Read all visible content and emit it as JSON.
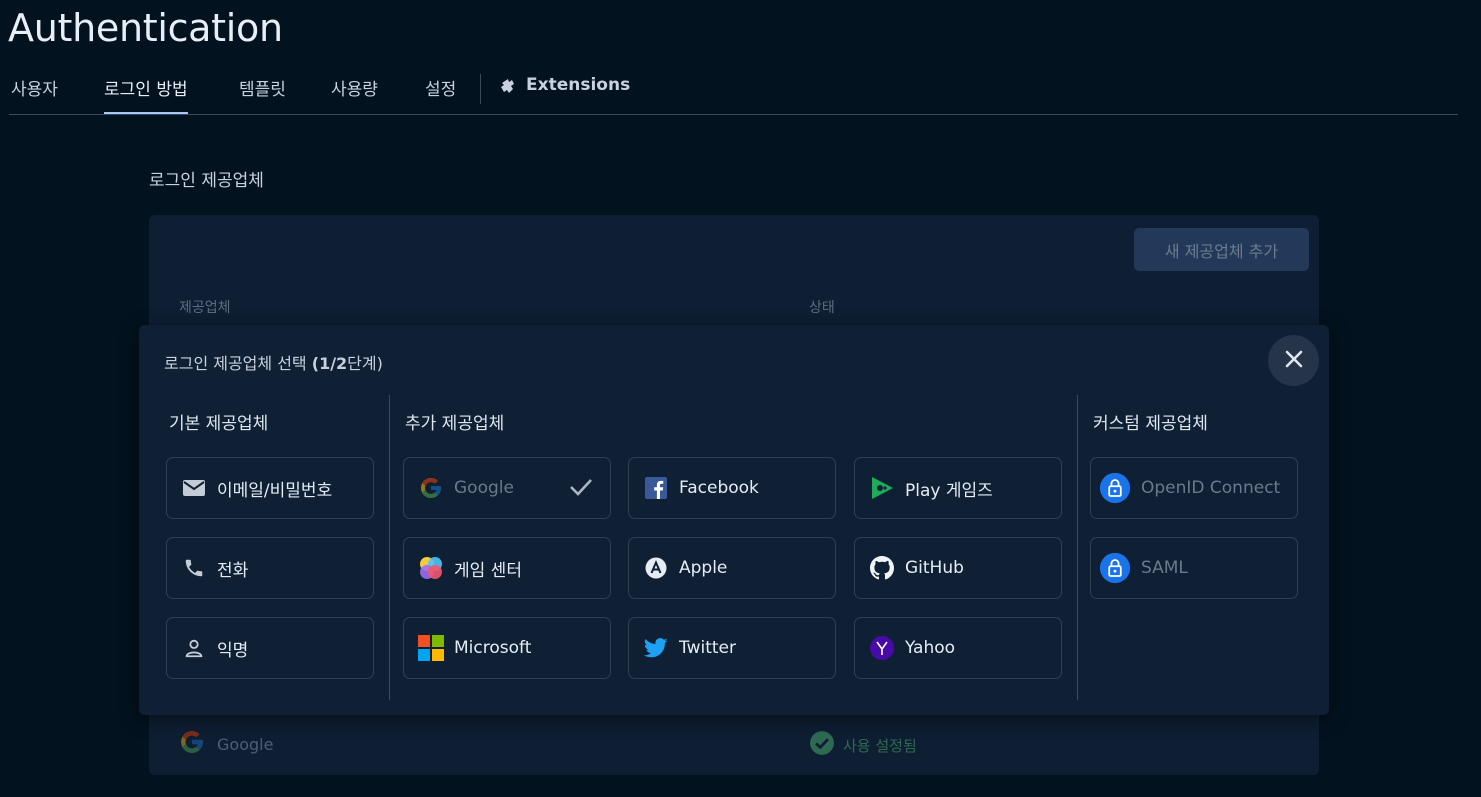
{
  "page": {
    "title": "Authentication"
  },
  "tabs": [
    {
      "label": "사용자"
    },
    {
      "label": "로그인 방법"
    },
    {
      "label": "템플릿"
    },
    {
      "label": "사용량"
    },
    {
      "label": "설정"
    },
    {
      "label": "Extensions"
    }
  ],
  "section": {
    "title": "로그인 제공업체"
  },
  "providers_table": {
    "add_button": "새 제공업체 추가",
    "columns": [
      "제공업체",
      "상태"
    ],
    "rows": [
      {
        "provider": "Google",
        "status": "사용 설정됨"
      }
    ]
  },
  "modal": {
    "title_prefix": "로그인 제공업체 선택",
    "title_step": "(1/2",
    "title_suffix": "단계)",
    "groups": {
      "native": "기본 제공업체",
      "additional": "추가 제공업체",
      "custom": "커스텀 제공업체"
    },
    "native_providers": [
      "이메일/비밀번호",
      "전화",
      "익명"
    ],
    "additional_providers": [
      "Google",
      "Facebook",
      "Play 게임즈",
      "게임 센터",
      "Apple",
      "GitHub",
      "Microsoft",
      "Twitter",
      "Yahoo"
    ],
    "custom_providers": [
      "OpenID Connect",
      "SAML"
    ]
  },
  "colors": {
    "background": "#03121f",
    "card": "#0e1f33",
    "accent": "#a8c7fa",
    "enabled": "#2e6a52"
  }
}
